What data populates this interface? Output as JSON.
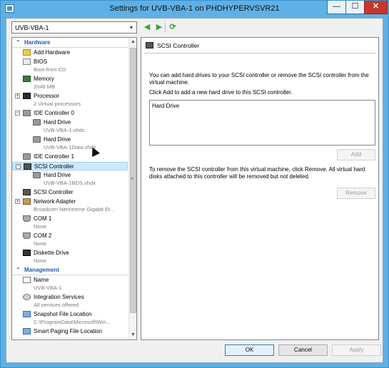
{
  "window": {
    "title": "Settings for UVB-VBA-1 on PHDHYPERVSVR21",
    "controls": {
      "minimize": "—",
      "maximize": "☐",
      "close": "✕"
    }
  },
  "vm_selector": {
    "value": "UVB-VBA-1",
    "arrow": "▾"
  },
  "nav": {
    "back": "◀",
    "forward": "▶",
    "refresh": "⟳"
  },
  "tree": {
    "hardware_header": "Hardware",
    "management_header": "Management",
    "hardware": [
      {
        "label": "Add Hardware",
        "icon": "add-hardware-icon"
      },
      {
        "label": "BIOS",
        "sub": "Boot from CD",
        "icon": "bios-icon"
      },
      {
        "label": "Memory",
        "sub": "2048 MB",
        "icon": "memory-icon"
      },
      {
        "label": "Processor",
        "sub": "2 Virtual processors",
        "icon": "processor-icon",
        "expander": "+"
      },
      {
        "label": "IDE Controller 0",
        "icon": "ide-controller-icon",
        "expander": "−"
      },
      {
        "label": "Hard Drive",
        "sub": "UVB-VBA-1.vhdx",
        "icon": "hard-drive-icon"
      },
      {
        "label": "Hard Drive",
        "sub": "UVB-VBA-1Data.vhdx",
        "icon": "hard-drive-icon"
      },
      {
        "label": "IDE Controller 1",
        "icon": "ide-controller-icon"
      },
      {
        "label": "SCSI Controller",
        "icon": "scsi-controller-icon",
        "expander": "−",
        "selected": true
      },
      {
        "label": "Hard Drive",
        "sub": "UVB-VBA-1BDS.vhdx",
        "icon": "hard-drive-icon"
      },
      {
        "label": "SCSI Controller",
        "icon": "scsi-controller-icon"
      },
      {
        "label": "Network Adapter",
        "sub": "Broadcom NetXtreme Gigabit Et...",
        "icon": "network-adapter-icon",
        "expander": "+"
      },
      {
        "label": "COM 1",
        "sub": "None",
        "icon": "com-port-icon"
      },
      {
        "label": "COM 2",
        "sub": "None",
        "icon": "com-port-icon"
      },
      {
        "label": "Diskette Drive",
        "sub": "None",
        "icon": "diskette-icon"
      }
    ],
    "management": [
      {
        "label": "Name",
        "sub": "UVB-VBA-1",
        "icon": "name-icon"
      },
      {
        "label": "Integration Services",
        "sub": "All services offered",
        "icon": "integration-services-icon"
      },
      {
        "label": "Snapshot File Location",
        "sub": "C:\\ProgramData\\Microsoft\\Win...",
        "icon": "snapshot-icon"
      },
      {
        "label": "Smart Paging File Location",
        "icon": "smart-paging-icon"
      }
    ]
  },
  "detail": {
    "title": "SCSI Controller",
    "intro": "You can add hard drives to your SCSI controller or remove the SCSI controller from the virtual machine.",
    "instruction": "Click Add to add a new hard drive to this SCSI controller.",
    "list_items": [
      "Hard Drive"
    ],
    "add_button": "Add",
    "remove_text": "To remove the SCSI controller from this virtual machine, click Remove. All virtual hard disks attached to this controller will be removed but not deleted.",
    "remove_button": "Remove"
  },
  "footer": {
    "ok": "OK",
    "cancel": "Cancel",
    "apply": "Apply"
  }
}
